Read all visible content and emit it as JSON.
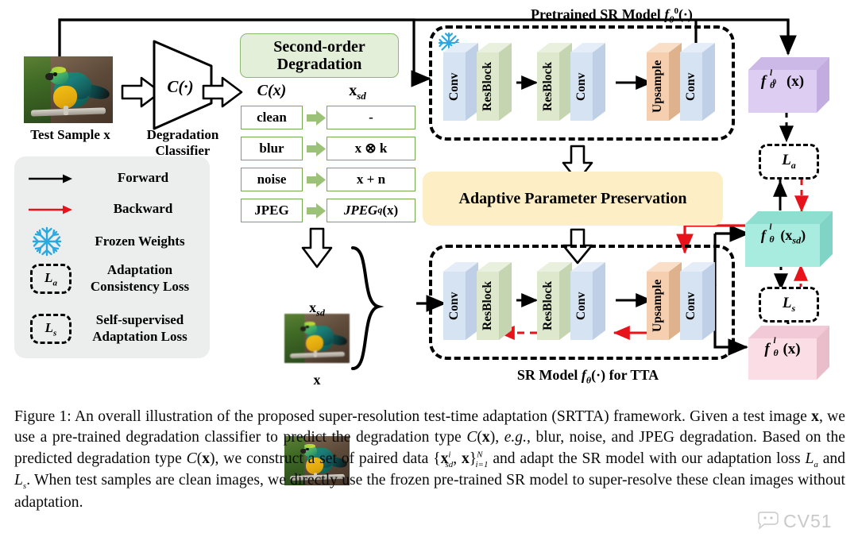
{
  "figure": {
    "test_sample": {
      "caption": "Test Sample x"
    },
    "classifier": {
      "symbol": "C(·)",
      "label_line1": "Degradation",
      "label_line2": "Classifier"
    },
    "degradation_panel": {
      "title_line1": "Second-order",
      "title_line2": "Degradation",
      "col1_header": "C(x)",
      "col2_header": "x",
      "col2_header_sub": "sd",
      "rows": [
        {
          "type": "clean",
          "result": "-"
        },
        {
          "type": "blur",
          "result": "x ⊗ k"
        },
        {
          "type": "noise",
          "result": "x + n"
        },
        {
          "type": "JPEG",
          "result": "JPEG",
          "result_sub": "q",
          "result_tail": "(x)"
        }
      ]
    },
    "pretrained_model": {
      "title_pre": "Pretrained SR Model ",
      "title_f": "f",
      "title_sub": "θ",
      "title_sup": "0",
      "title_post": "(·)",
      "layers": [
        "Conv",
        "ResBlock",
        "ResBlock",
        "Conv",
        "Upsample",
        "Conv"
      ],
      "frozen_icon": "snowflake-icon"
    },
    "app_banner": {
      "label": "Adaptive Parameter Preservation"
    },
    "tta_model": {
      "layers": [
        "Conv",
        "ResBlock",
        "ResBlock",
        "Conv",
        "Upsample",
        "Conv"
      ],
      "title_pre": "SR Model ",
      "title_f": "f",
      "title_sub": "θ",
      "title_post": "(·) for TTA"
    },
    "paired_inputs": {
      "top_label_base": "x",
      "top_label_sub": "sd",
      "bottom_label": "x"
    },
    "outputs": [
      {
        "id": "pretrained-output",
        "f": "f",
        "sup": "l",
        "sub": "θ",
        "subsup": "0",
        "arg": "(x)",
        "color": "#ddcdf2"
      },
      {
        "id": "tta-output-sd",
        "f": "f",
        "sup": "l",
        "sub": "θ",
        "subsup": "",
        "arg": "(x_sd)",
        "color": "#a8ecdf"
      },
      {
        "id": "tta-output-x",
        "f": "f",
        "sup": "l",
        "sub": "θ",
        "subsup": "",
        "arg": "(x)",
        "color": "#fbdde6"
      }
    ],
    "losses": [
      {
        "id": "adaptation-consistency-loss",
        "symbol": "L",
        "sub": "a"
      },
      {
        "id": "self-supervised-adaptation-loss",
        "symbol": "L",
        "sub": "s"
      }
    ],
    "legend": {
      "items": [
        {
          "icon": "black-arrow-icon",
          "label": "Forward",
          "label2": ""
        },
        {
          "icon": "red-arrow-icon",
          "label": "Backward",
          "label2": ""
        },
        {
          "icon": "snowflake-icon",
          "label": "Frozen Weights",
          "label2": ""
        },
        {
          "icon": "loss-la-icon",
          "label": "Adaptation",
          "label2": "Consistency Loss"
        },
        {
          "icon": "loss-ls-icon",
          "label": "Self-supervised",
          "label2": "Adaptation Loss"
        }
      ]
    },
    "colors": {
      "conv": "#d5e3f3",
      "resblock": "#dde8cd",
      "upsample": "#f5cfb0",
      "panel_green": "#e3efd9",
      "panel_green_border": "#8cb870",
      "panel_yellow": "#fdeec6",
      "legend_bg": "#eceded",
      "backward_red": "#e8131a",
      "snowflake_blue": "#2aa8e0",
      "output_purple": "#ddcdf2",
      "output_teal": "#a8ecdf",
      "output_pink": "#fbdde6"
    }
  },
  "caption": {
    "prefix": "Figure 1:",
    "text": " An overall illustration of the proposed super-resolution test-time adaptation (SRTTA) framework. Given a test image x, we use a pre-trained degradation classifier to predict the degradation type C(x), e.g., blur, noise, and JPEG degradation. Based on the predicted degradation type C(x), we construct a set of paired data {x_sd^i, x}_{i=1}^{N} and adapt the SR model with our adaptation loss L_a and L_s. When test samples are clean images, we directly use the frozen pre-trained SR model to super-resolve these clean images without adaptation."
  },
  "watermark": {
    "text": "CV51",
    "icon": "chat-bubble-icon"
  }
}
